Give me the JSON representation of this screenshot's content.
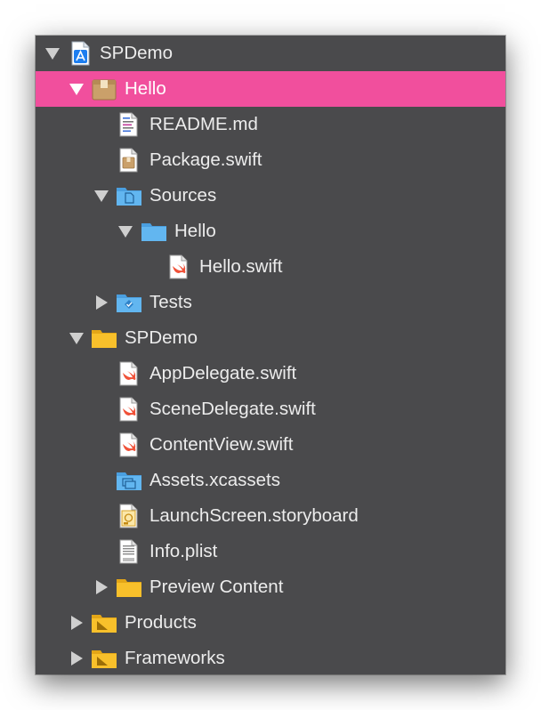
{
  "navigator": {
    "rows": [
      {
        "label": "SPDemo",
        "icon": "xcode-project-icon",
        "disclosure": "expanded",
        "selected": false
      },
      {
        "label": "Hello",
        "icon": "swift-package-icon",
        "disclosure": "expanded",
        "selected": true
      },
      {
        "label": "README.md",
        "icon": "markdown-file-icon",
        "disclosure": "none",
        "selected": false
      },
      {
        "label": "Package.swift",
        "icon": "package-manifest-icon",
        "disclosure": "none",
        "selected": false
      },
      {
        "label": "Sources",
        "icon": "sources-folder-icon",
        "disclosure": "expanded",
        "selected": false
      },
      {
        "label": "Hello",
        "icon": "blue-folder-icon",
        "disclosure": "expanded",
        "selected": false
      },
      {
        "label": "Hello.swift",
        "icon": "swift-file-icon",
        "disclosure": "none",
        "selected": false
      },
      {
        "label": "Tests",
        "icon": "tests-folder-icon",
        "disclosure": "collapsed",
        "selected": false
      },
      {
        "label": "SPDemo",
        "icon": "yellow-folder-icon",
        "disclosure": "expanded",
        "selected": false
      },
      {
        "label": "AppDelegate.swift",
        "icon": "swift-file-icon",
        "disclosure": "none",
        "selected": false
      },
      {
        "label": "SceneDelegate.swift",
        "icon": "swift-file-icon",
        "disclosure": "none",
        "selected": false
      },
      {
        "label": "ContentView.swift",
        "icon": "swift-file-icon",
        "disclosure": "none",
        "selected": false
      },
      {
        "label": "Assets.xcassets",
        "icon": "asset-catalog-icon",
        "disclosure": "none",
        "selected": false
      },
      {
        "label": "LaunchScreen.storyboard",
        "icon": "storyboard-file-icon",
        "disclosure": "none",
        "selected": false
      },
      {
        "label": "Info.plist",
        "icon": "plist-file-icon",
        "disclosure": "none",
        "selected": false
      },
      {
        "label": "Preview Content",
        "icon": "yellow-folder-icon",
        "disclosure": "collapsed",
        "selected": false
      },
      {
        "label": "Products",
        "icon": "products-folder-icon",
        "disclosure": "collapsed",
        "selected": false
      },
      {
        "label": "Frameworks",
        "icon": "frameworks-folder-icon",
        "disclosure": "collapsed",
        "selected": false
      }
    ]
  },
  "colors": {
    "background": "#4a4a4c",
    "selection": "#f14f9d",
    "text": "#ececec",
    "folder_yellow": "#f8c02b",
    "folder_blue": "#5ab3ec",
    "swift_orange": "#f05138"
  }
}
